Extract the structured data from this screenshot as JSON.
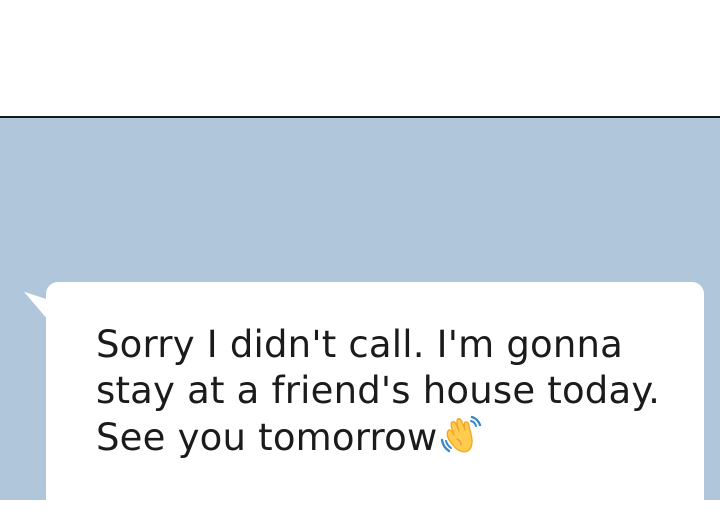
{
  "message": {
    "lines": [
      "Sorry I didn't call. I'm gonna",
      "stay at a friend's house today.",
      "See you tomorrow"
    ],
    "emoji_icon": "waving-hand-icon"
  },
  "colors": {
    "chat_background": "#b0c6db",
    "bubble": "#ffffff",
    "text": "#1b1b1b",
    "divider": "#1a1a1a"
  }
}
